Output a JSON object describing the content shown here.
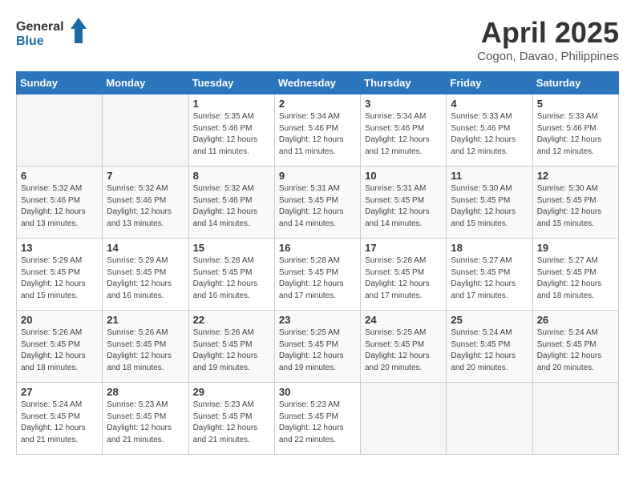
{
  "header": {
    "logo_general": "General",
    "logo_blue": "Blue",
    "month_year": "April 2025",
    "location": "Cogon, Davao, Philippines"
  },
  "weekdays": [
    "Sunday",
    "Monday",
    "Tuesday",
    "Wednesday",
    "Thursday",
    "Friday",
    "Saturday"
  ],
  "weeks": [
    [
      {
        "day": "",
        "info": ""
      },
      {
        "day": "",
        "info": ""
      },
      {
        "day": "1",
        "info": "Sunrise: 5:35 AM\nSunset: 5:46 PM\nDaylight: 12 hours\nand 11 minutes."
      },
      {
        "day": "2",
        "info": "Sunrise: 5:34 AM\nSunset: 5:46 PM\nDaylight: 12 hours\nand 11 minutes."
      },
      {
        "day": "3",
        "info": "Sunrise: 5:34 AM\nSunset: 5:46 PM\nDaylight: 12 hours\nand 12 minutes."
      },
      {
        "day": "4",
        "info": "Sunrise: 5:33 AM\nSunset: 5:46 PM\nDaylight: 12 hours\nand 12 minutes."
      },
      {
        "day": "5",
        "info": "Sunrise: 5:33 AM\nSunset: 5:46 PM\nDaylight: 12 hours\nand 12 minutes."
      }
    ],
    [
      {
        "day": "6",
        "info": "Sunrise: 5:32 AM\nSunset: 5:46 PM\nDaylight: 12 hours\nand 13 minutes."
      },
      {
        "day": "7",
        "info": "Sunrise: 5:32 AM\nSunset: 5:46 PM\nDaylight: 12 hours\nand 13 minutes."
      },
      {
        "day": "8",
        "info": "Sunrise: 5:32 AM\nSunset: 5:46 PM\nDaylight: 12 hours\nand 14 minutes."
      },
      {
        "day": "9",
        "info": "Sunrise: 5:31 AM\nSunset: 5:45 PM\nDaylight: 12 hours\nand 14 minutes."
      },
      {
        "day": "10",
        "info": "Sunrise: 5:31 AM\nSunset: 5:45 PM\nDaylight: 12 hours\nand 14 minutes."
      },
      {
        "day": "11",
        "info": "Sunrise: 5:30 AM\nSunset: 5:45 PM\nDaylight: 12 hours\nand 15 minutes."
      },
      {
        "day": "12",
        "info": "Sunrise: 5:30 AM\nSunset: 5:45 PM\nDaylight: 12 hours\nand 15 minutes."
      }
    ],
    [
      {
        "day": "13",
        "info": "Sunrise: 5:29 AM\nSunset: 5:45 PM\nDaylight: 12 hours\nand 15 minutes."
      },
      {
        "day": "14",
        "info": "Sunrise: 5:29 AM\nSunset: 5:45 PM\nDaylight: 12 hours\nand 16 minutes."
      },
      {
        "day": "15",
        "info": "Sunrise: 5:28 AM\nSunset: 5:45 PM\nDaylight: 12 hours\nand 16 minutes."
      },
      {
        "day": "16",
        "info": "Sunrise: 5:28 AM\nSunset: 5:45 PM\nDaylight: 12 hours\nand 17 minutes."
      },
      {
        "day": "17",
        "info": "Sunrise: 5:28 AM\nSunset: 5:45 PM\nDaylight: 12 hours\nand 17 minutes."
      },
      {
        "day": "18",
        "info": "Sunrise: 5:27 AM\nSunset: 5:45 PM\nDaylight: 12 hours\nand 17 minutes."
      },
      {
        "day": "19",
        "info": "Sunrise: 5:27 AM\nSunset: 5:45 PM\nDaylight: 12 hours\nand 18 minutes."
      }
    ],
    [
      {
        "day": "20",
        "info": "Sunrise: 5:26 AM\nSunset: 5:45 PM\nDaylight: 12 hours\nand 18 minutes."
      },
      {
        "day": "21",
        "info": "Sunrise: 5:26 AM\nSunset: 5:45 PM\nDaylight: 12 hours\nand 18 minutes."
      },
      {
        "day": "22",
        "info": "Sunrise: 5:26 AM\nSunset: 5:45 PM\nDaylight: 12 hours\nand 19 minutes."
      },
      {
        "day": "23",
        "info": "Sunrise: 5:25 AM\nSunset: 5:45 PM\nDaylight: 12 hours\nand 19 minutes."
      },
      {
        "day": "24",
        "info": "Sunrise: 5:25 AM\nSunset: 5:45 PM\nDaylight: 12 hours\nand 20 minutes."
      },
      {
        "day": "25",
        "info": "Sunrise: 5:24 AM\nSunset: 5:45 PM\nDaylight: 12 hours\nand 20 minutes."
      },
      {
        "day": "26",
        "info": "Sunrise: 5:24 AM\nSunset: 5:45 PM\nDaylight: 12 hours\nand 20 minutes."
      }
    ],
    [
      {
        "day": "27",
        "info": "Sunrise: 5:24 AM\nSunset: 5:45 PM\nDaylight: 12 hours\nand 21 minutes."
      },
      {
        "day": "28",
        "info": "Sunrise: 5:23 AM\nSunset: 5:45 PM\nDaylight: 12 hours\nand 21 minutes."
      },
      {
        "day": "29",
        "info": "Sunrise: 5:23 AM\nSunset: 5:45 PM\nDaylight: 12 hours\nand 21 minutes."
      },
      {
        "day": "30",
        "info": "Sunrise: 5:23 AM\nSunset: 5:45 PM\nDaylight: 12 hours\nand 22 minutes."
      },
      {
        "day": "",
        "info": ""
      },
      {
        "day": "",
        "info": ""
      },
      {
        "day": "",
        "info": ""
      }
    ]
  ]
}
